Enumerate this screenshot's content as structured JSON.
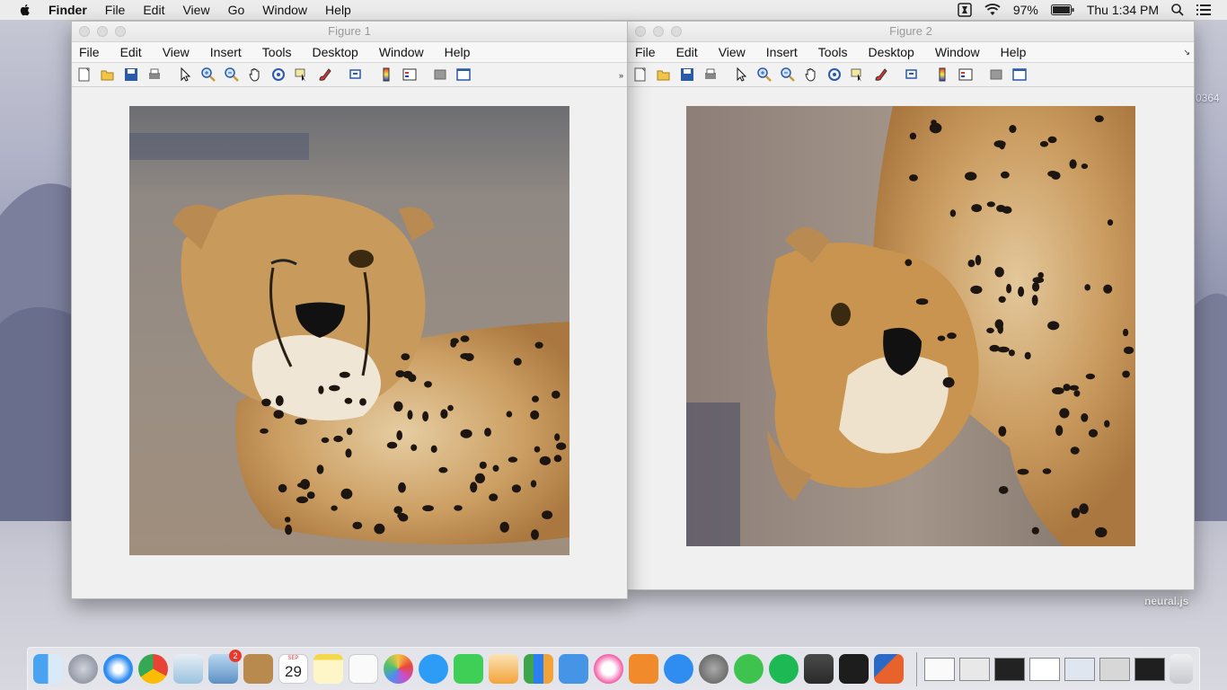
{
  "menubar": {
    "app": "Finder",
    "items": [
      "File",
      "Edit",
      "View",
      "Go",
      "Window",
      "Help"
    ],
    "battery": "97%",
    "clock": "Thu 1:34 PM"
  },
  "figure1": {
    "title": "Figure 1",
    "menu": [
      "File",
      "Edit",
      "View",
      "Insert",
      "Tools",
      "Desktop",
      "Window",
      "Help"
    ]
  },
  "figure2": {
    "title": "Figure 2",
    "menu": [
      "File",
      "Edit",
      "View",
      "Insert",
      "Tools",
      "Desktop",
      "Window",
      "Help"
    ]
  },
  "toolbar_icons": [
    "new-figure-icon",
    "open-file-icon",
    "save-icon",
    "print-icon",
    "edit-plot-icon",
    "zoom-in-icon",
    "zoom-out-icon",
    "pan-icon",
    "rotate-3d-icon",
    "data-cursor-icon",
    "brush-icon",
    "link-plot-icon",
    "colorbar-icon",
    "legend-icon",
    "hide-plot-tools-icon",
    "show-plot-tools-icon"
  ],
  "desktop": {
    "partial_text": "0364",
    "watermark": "neural.js"
  },
  "dock": {
    "mail_badge": "2",
    "calendar_month": "SEP",
    "calendar_day": "29"
  },
  "colors": {
    "cheetah_fur": "#c89a5c",
    "background_gray": "#f0f0f0"
  }
}
